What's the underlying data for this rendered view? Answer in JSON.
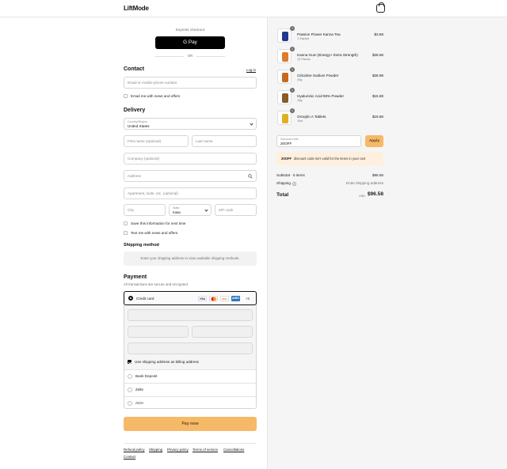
{
  "header": {
    "logo": "LiftMode",
    "cart_icon": "shopping-bag-icon"
  },
  "express": {
    "title": "Express checkout",
    "gpay_label": "G Pay",
    "or": "OR"
  },
  "contact": {
    "title": "Contact",
    "login_link": "Log in",
    "email_placeholder": "Email or mobile phone number",
    "news_label": "Email me with news and offers"
  },
  "delivery": {
    "title": "Delivery",
    "country_label": "Country/Region",
    "country_value": "United States",
    "first_name": "First name (optional)",
    "last_name": "Last name",
    "company": "Company (optional)",
    "address": "Address",
    "apartment": "Apartment, suite, etc. (optional)",
    "city": "City",
    "state_label": "State",
    "state_value": "Iowa",
    "zip": "ZIP code",
    "save_info": "Save this information for next time",
    "text_me": "Text me with news and offers"
  },
  "shipping_method": {
    "title": "Shipping method",
    "message": "Enter your shipping address to view available shipping methods."
  },
  "payment": {
    "title": "Payment",
    "subtitle": "All transactions are secure and encrypted.",
    "credit_card": "Credit card",
    "badges": [
      "VISA",
      "MC",
      "DISC",
      "AMEX"
    ],
    "more": "+3",
    "billing_same": "Use shipping address as billing address",
    "options": [
      "Bank Deposit",
      "Zelle",
      "ACH"
    ]
  },
  "pay_button": "Pay now",
  "footer_links": [
    "Refund policy",
    "Shipping",
    "Privacy policy",
    "Terms of service",
    "Cancellations",
    "Contact"
  ],
  "cart": {
    "items": [
      {
        "name": "Passion Flower Kanna Tea",
        "variant": "1 Sachet",
        "price": "$3.86",
        "qty": "1",
        "color": "#1f3b8c"
      },
      {
        "name": "Kanna Gum (Energy+ Extra Strength)",
        "variant": "12 Pieces",
        "price": "$28.68",
        "qty": "1",
        "color": "#e07a2e"
      },
      {
        "name": "Citicoline Sodium Powder",
        "variant": "20g",
        "price": "$28.68",
        "qty": "1",
        "color": "#c9691f"
      },
      {
        "name": "Hyaluronic Acid 96% Powder",
        "variant": "10g",
        "price": "$15.68",
        "qty": "1",
        "color": "#8a5a2b"
      },
      {
        "name": "Oroxylin A Tablets",
        "variant": "10ct",
        "price": "$19.68",
        "qty": "1",
        "color": "#e0b020"
      }
    ],
    "discount_label": "Discount code",
    "discount_value": "20OFF",
    "apply": "Apply",
    "discount_error_code": "20OFF",
    "discount_error": "discount code isn't valid for the items in your cart",
    "subtotal_label": "Subtotal · 5 items",
    "subtotal_value": "$96.58",
    "shipping_label": "Shipping",
    "shipping_value": "Enter shipping address",
    "total_label": "Total",
    "currency": "USD",
    "total_value": "$96.58"
  },
  "colors": {
    "accent": "#f6b968",
    "error_bg": "#fdf0df",
    "panel_bg": "#f5f5f5"
  }
}
